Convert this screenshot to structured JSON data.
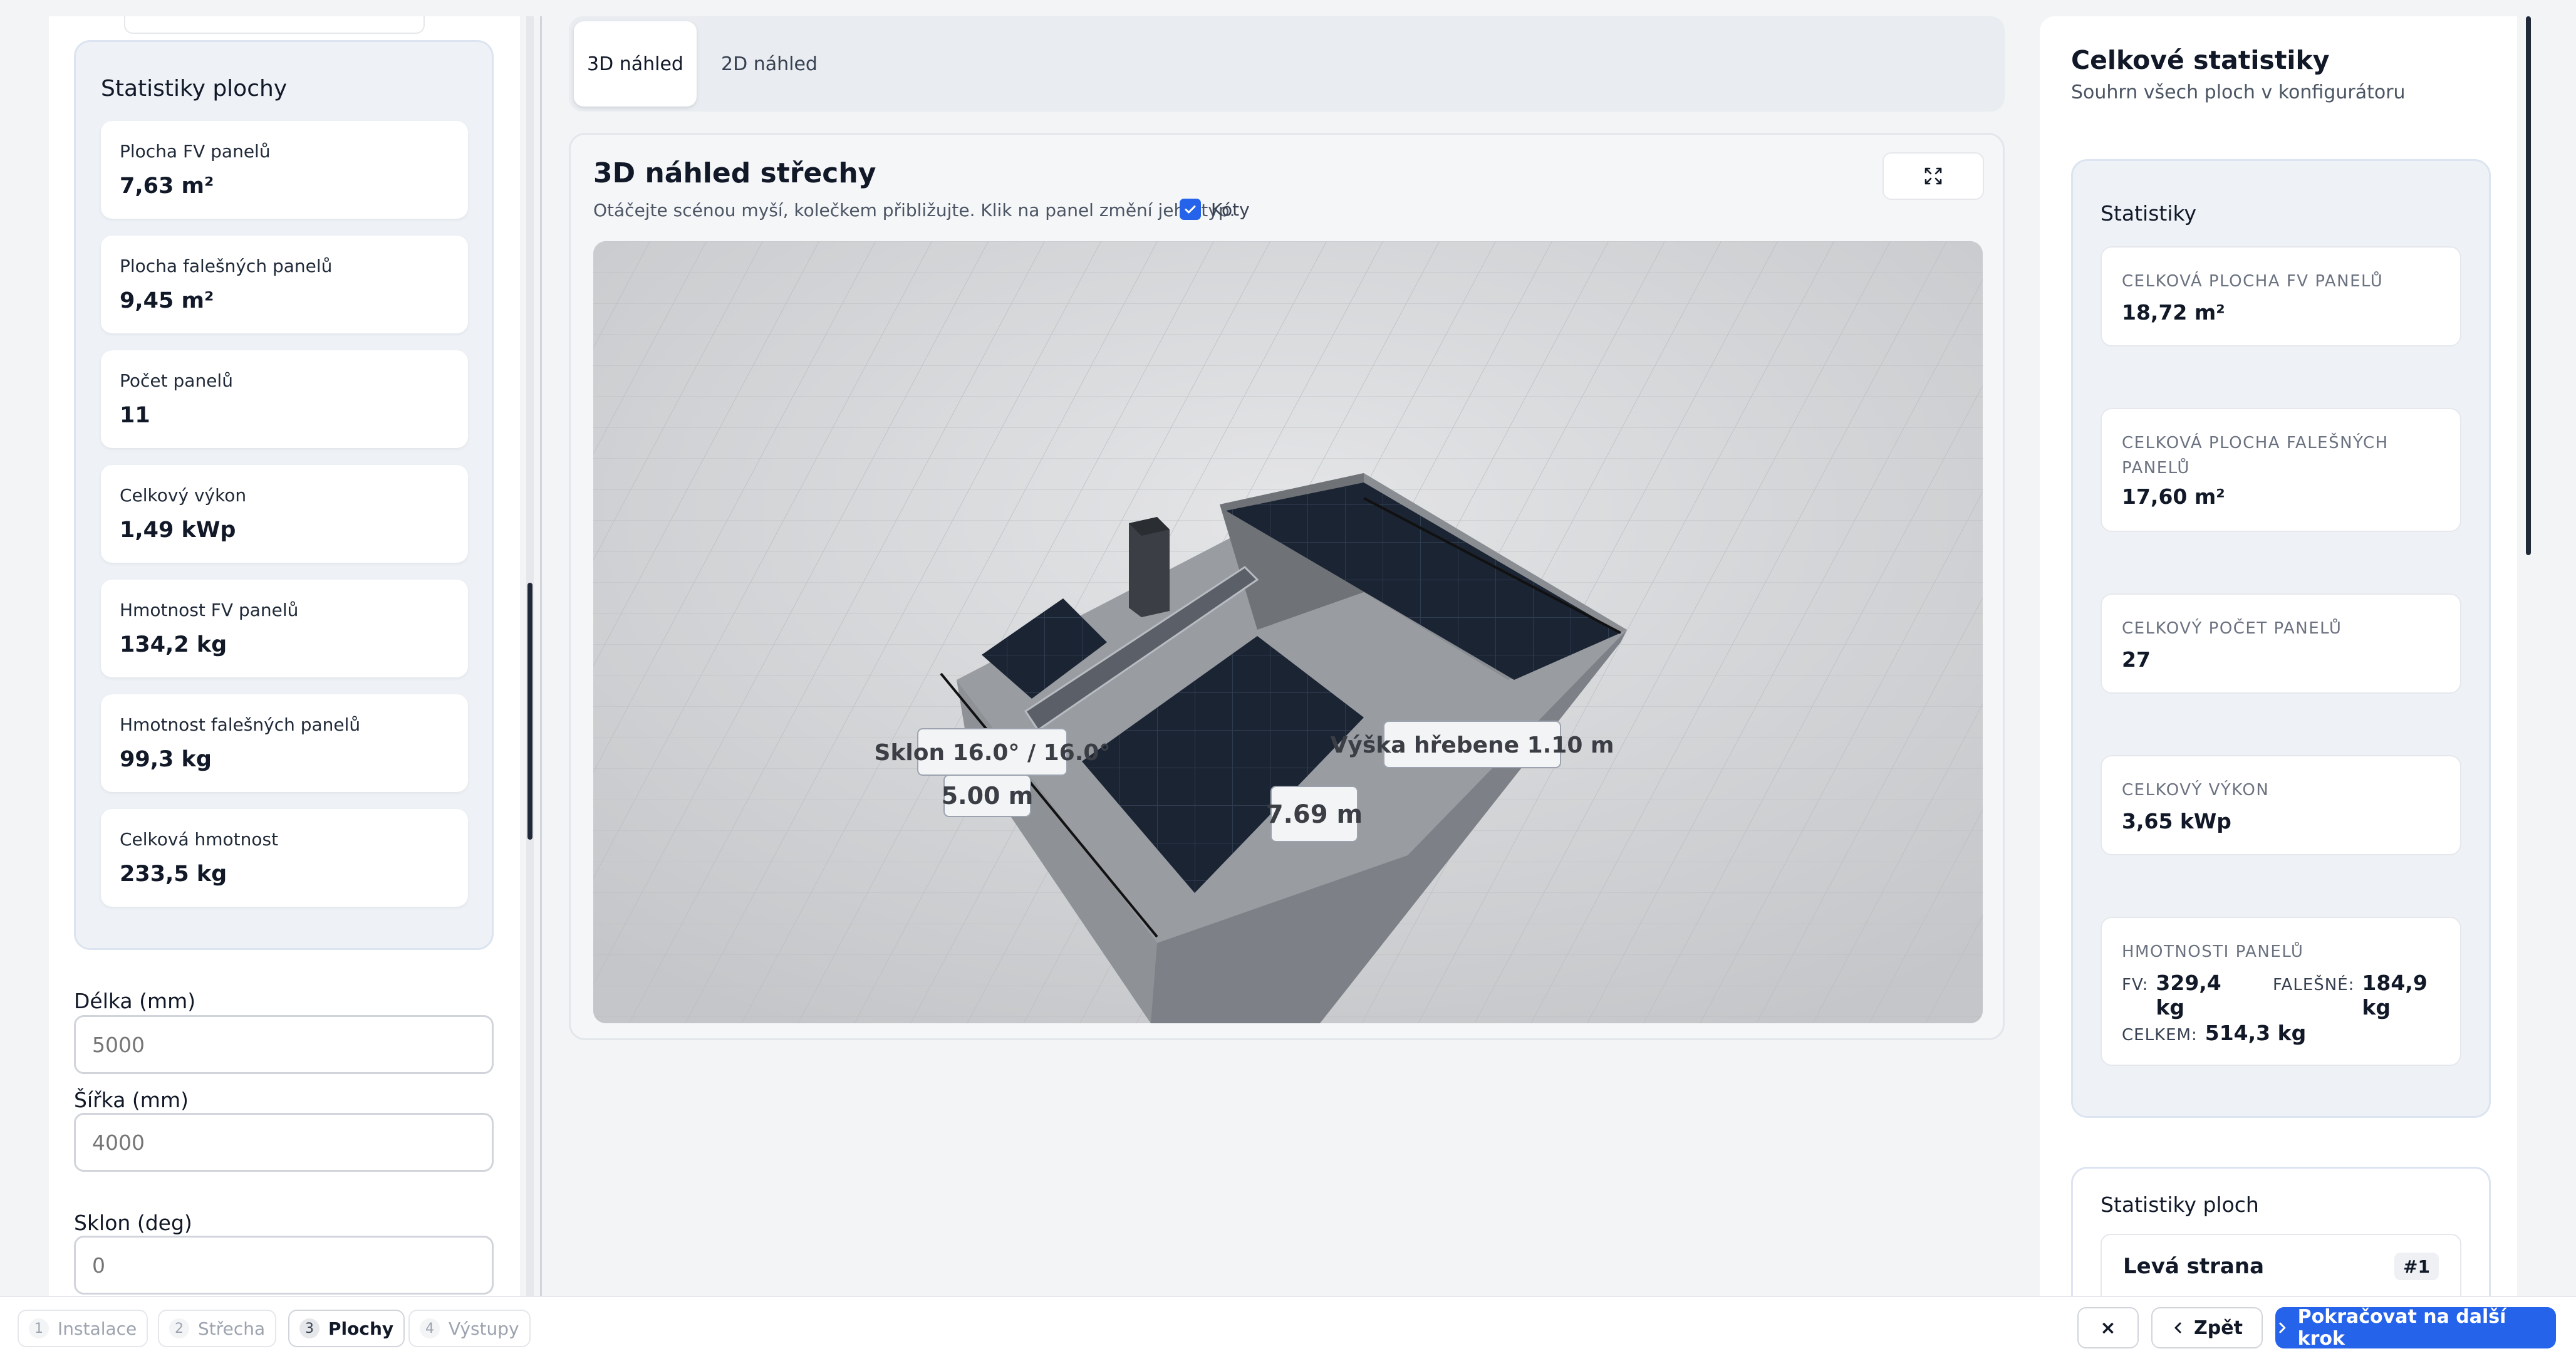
{
  "left": {
    "stats_title": "Statistiky plochy",
    "items": [
      {
        "label": "Plocha FV panelů",
        "value": "7,63 m²"
      },
      {
        "label": "Plocha falešných panelů",
        "value": "9,45 m²"
      },
      {
        "label": "Počet panelů",
        "value": "11"
      },
      {
        "label": "Celkový výkon",
        "value": "1,49 kWp"
      },
      {
        "label": "Hmotnost FV panelů",
        "value": "134,2 kg"
      },
      {
        "label": "Hmotnost falešných panelů",
        "value": "99,3 kg"
      },
      {
        "label": "Celková hmotnost",
        "value": "233,5 kg"
      }
    ],
    "fields": {
      "delka_label": "Délka (mm)",
      "delka_placeholder": "5000",
      "sirka_label": "Šířka (mm)",
      "sirka_placeholder": "4000",
      "sklon_label": "Sklon (deg)",
      "sklon_placeholder": "0"
    }
  },
  "tabs": {
    "view3d": "3D náhled",
    "view2d": "2D náhled"
  },
  "view": {
    "title": "3D náhled střechy",
    "hint": "Otáčejte scénou myší, kolečkem přibližujte. Klik na panel změní jeho typ.",
    "koty_label": "Kóty",
    "koty_checked": true,
    "labels": {
      "sklon": "Sklon 16.0° / 16.0°",
      "sirka": "5.00 m",
      "delka": "7.69 m",
      "hreben": "Výška hřebene 1.10 m"
    }
  },
  "right": {
    "title": "Celkové statistiky",
    "subtitle": "Souhrn všech ploch v konfigurátoru",
    "stats_title": "Statistiky",
    "plocha_fv_label": "CELKOVÁ PLOCHA FV PANELŮ",
    "plocha_fv_value": "18,72 m²",
    "plocha_fake_label": "CELKOVÁ PLOCHA FALEŠNÝCH PANELŮ",
    "plocha_fake_value": "17,60 m²",
    "pocet_label": "CELKOVÝ POČET PANELŮ",
    "pocet_value": "27",
    "vykon_label": "CELKOVÝ VÝKON",
    "vykon_value": "3,65 kWp",
    "hmotnosti_label": "HMOTNOSTI PANELŮ",
    "fv_key": "FV:",
    "fv_value": "329,4 kg",
    "fake_key": "FALEŠNÉ:",
    "fake_value": "184,9 kg",
    "celkem_key": "CELKEM:",
    "celkem_value": "514,3 kg",
    "plochy_title": "Statistiky ploch",
    "strana_name": "Levá strana",
    "strana_badge": "#1"
  },
  "steps": [
    {
      "num": "1",
      "label": "Instalace"
    },
    {
      "num": "2",
      "label": "Střecha"
    },
    {
      "num": "3",
      "label": "Plochy"
    },
    {
      "num": "4",
      "label": "Výstupy"
    }
  ],
  "buttons": {
    "close": "×",
    "back": "Zpět",
    "next": "Pokračovat na další krok"
  },
  "colors": {
    "accent": "#2563eb",
    "panel": "#1b2433"
  }
}
